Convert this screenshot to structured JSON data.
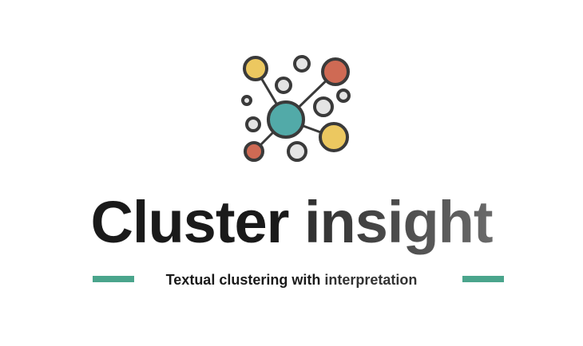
{
  "title": {
    "word1": "Cluster",
    "word2": " insight"
  },
  "subtitle": {
    "part1": "Textual clustering with",
    "part2": " interpretation"
  },
  "logo": {
    "icon": "network-cluster-icon"
  },
  "colors": {
    "accent_bar": "#4aa58c",
    "node_teal": "#52aaa8",
    "node_yellow": "#ecc860",
    "node_red": "#cf6a54",
    "node_gray": "#e4e4e4",
    "stroke": "#3a3a3a"
  }
}
